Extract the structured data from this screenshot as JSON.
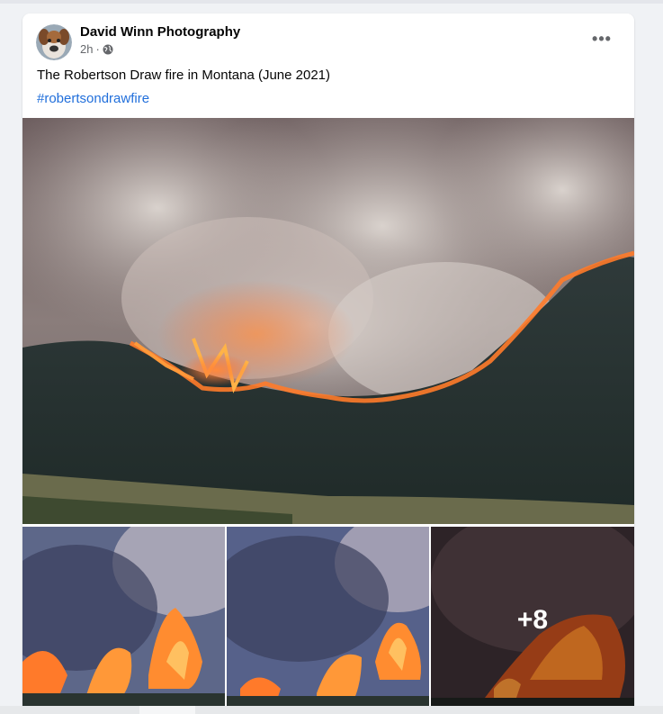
{
  "post": {
    "author": "David Winn Photography",
    "time": "2h",
    "separator": "·",
    "privacy_icon": "globe-icon",
    "more_icon": "more-options-icon",
    "more_label": "•••",
    "caption": "The Robertson Draw fire in Montana (June 2021)",
    "hashtag": "#robertsondrawfire",
    "extra_photos": "+8"
  },
  "colors": {
    "link": "#216fdb",
    "text": "#050505",
    "secondary_text": "#65676b",
    "card_bg": "#ffffff",
    "page_bg": "#f0f2f5"
  }
}
